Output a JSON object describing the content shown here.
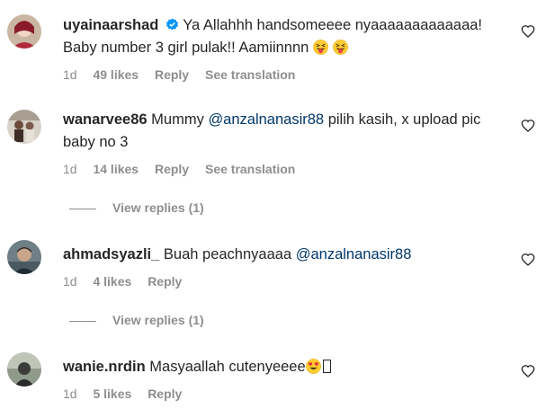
{
  "comments": [
    {
      "username": "uyainaarshad",
      "verified": true,
      "text_line1": "Ya Allahhh handsomeeee nyaaaaaaaaaaaaa!",
      "text_line2": "Baby number 3 girl pulak!! Aamiinnnn",
      "emojis": [
        "squinting-tongue-emoji",
        "squinting-tongue-emoji"
      ],
      "time": "1d",
      "likes": "49 likes",
      "reply": "Reply",
      "translate": "See translation"
    },
    {
      "username": "wanarvee86",
      "text_before": "Mummy",
      "mention": "@anzalnanasir88",
      "text_after": "pilih kasih, x upload pic",
      "text_line2": "baby no 3",
      "time": "1d",
      "likes": "14 likes",
      "reply": "Reply",
      "translate": "See translation",
      "view_replies": "View replies (1)"
    },
    {
      "username": "ahmadsyazli_",
      "text_before": "Buah peachnyaaaa",
      "mention": "@anzalnanasir88",
      "time": "1d",
      "likes": "4 likes",
      "reply": "Reply",
      "view_replies": "View replies (1)"
    },
    {
      "username": "wanie.nrdin",
      "text_before": "Masyaallah cutenyeeee",
      "emojis": [
        "heart-eyes-emoji"
      ],
      "time": "1d",
      "likes": "5 likes",
      "reply": "Reply"
    }
  ],
  "colors": {
    "text": "#262626",
    "meta": "#8e8e8e",
    "mention": "#00376b",
    "verified": "#0095f6"
  },
  "icons": [
    "heart-outline-icon",
    "verified-badge-icon"
  ]
}
